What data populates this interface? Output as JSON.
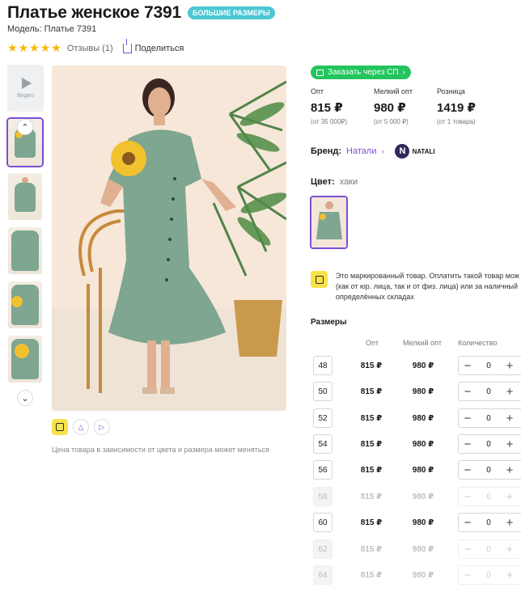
{
  "product": {
    "title": "Платье женское 7391",
    "badge": "БОЛЬШИЕ РАЗМЕРЫ",
    "model": "Модель: Платье 7391",
    "rating_stars": 5,
    "reviews": "Отзывы (1)",
    "share": "Поделиться"
  },
  "gallery": {
    "video_label": "Видео",
    "thumbnails": [
      {
        "active": true
      },
      {
        "active": false
      },
      {
        "active": false
      },
      {
        "active": false
      },
      {
        "active": false
      }
    ],
    "price_note": "Цена товара в зависимости от цвета и размера может меняться"
  },
  "order_button": "Заказать через СП",
  "prices": [
    {
      "label": "Опт",
      "value": "815 ₽",
      "sub": "(от 35 000₽)"
    },
    {
      "label": "Мелкий опт",
      "value": "980 ₽",
      "sub": "(от 5 000 ₽)"
    },
    {
      "label": "Розница",
      "value": "1419 ₽",
      "sub": "(от 1 товара)"
    }
  ],
  "brand": {
    "label": "Бренд:",
    "name": "Натали",
    "logo_text": "NATALI",
    "logo_letter": "N"
  },
  "color": {
    "label": "Цвет:",
    "value": "хаки"
  },
  "marking": {
    "line1": "Это маркированный товар. Оплатить такой товар мож",
    "line2": "(как от юр. лица, так и от физ. лица) или за наличный",
    "line3": "определённых складах"
  },
  "sizes": {
    "title": "Размеры",
    "headers": {
      "opt": "Опт",
      "small_opt": "Мелкий опт",
      "qty": "Количество"
    },
    "rows": [
      {
        "size": "48",
        "opt": "815 ₽",
        "small_opt": "980 ₽",
        "qty": "0",
        "available": true
      },
      {
        "size": "50",
        "opt": "815 ₽",
        "small_opt": "980 ₽",
        "qty": "0",
        "available": true
      },
      {
        "size": "52",
        "opt": "815 ₽",
        "small_opt": "980 ₽",
        "qty": "0",
        "available": true
      },
      {
        "size": "54",
        "opt": "815 ₽",
        "small_opt": "980 ₽",
        "qty": "0",
        "available": true
      },
      {
        "size": "56",
        "opt": "815 ₽",
        "small_opt": "980 ₽",
        "qty": "0",
        "available": true
      },
      {
        "size": "58",
        "opt": "815 ₽",
        "small_opt": "980 ₽",
        "qty": "0",
        "available": false
      },
      {
        "size": "60",
        "opt": "815 ₽",
        "small_opt": "980 ₽",
        "qty": "0",
        "available": true
      },
      {
        "size": "62",
        "opt": "815 ₽",
        "small_opt": "980 ₽",
        "qty": "0",
        "available": false
      },
      {
        "size": "64",
        "opt": "815 ₽",
        "small_opt": "980 ₽",
        "qty": "0",
        "available": false
      }
    ]
  },
  "colors": {
    "accent": "#7a4fd6",
    "order_green": "#23c45e",
    "badge_teal": "#4cc7d3",
    "star": "#ffb400"
  }
}
